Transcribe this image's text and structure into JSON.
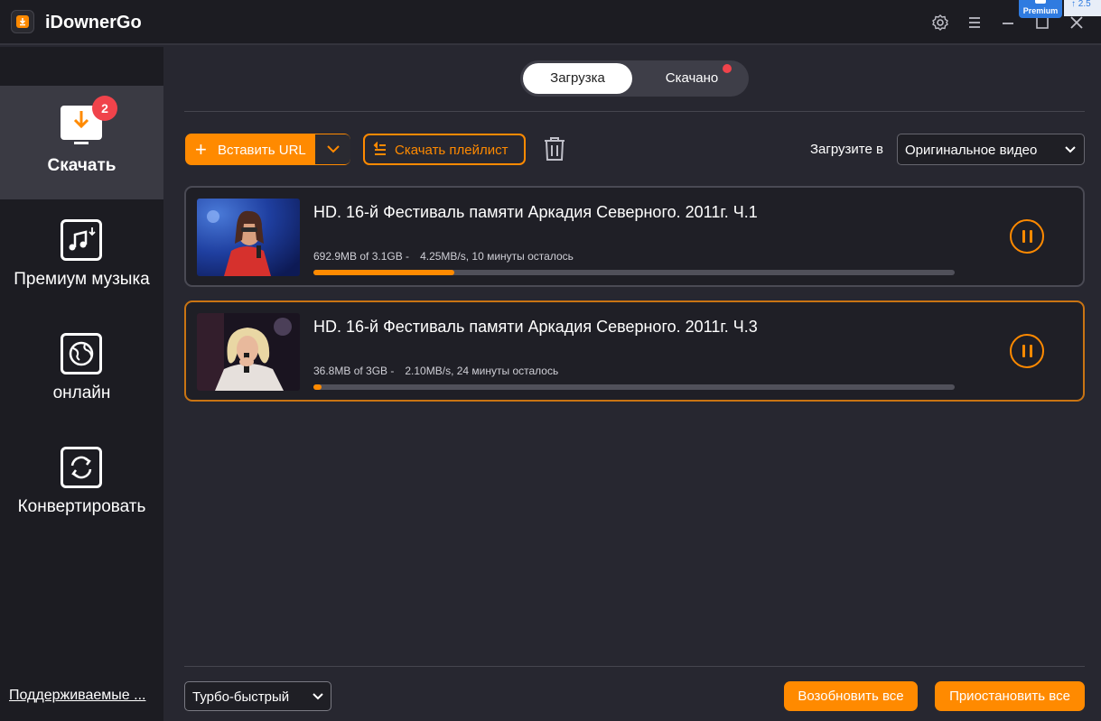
{
  "app": {
    "title": "iDownerGo",
    "premium_label": "Premium",
    "corner_peek_text": "↑ 2.5",
    "icons": [
      "app-logo-icon",
      "settings-icon",
      "menu-icon",
      "minimize-icon",
      "maximize-icon",
      "close-icon"
    ]
  },
  "sidebar": {
    "items": [
      {
        "label": "Скачать",
        "icon": "download-monitor-icon",
        "badge": "2",
        "active": true
      },
      {
        "label": "Премиум музыка",
        "icon": "music-download-icon",
        "active": false
      },
      {
        "label": "онлайн",
        "icon": "globe-icon",
        "active": false
      },
      {
        "label": "Конвертировать",
        "icon": "convert-icon",
        "active": false
      }
    ],
    "supported_link": "Поддерживаемые ..."
  },
  "tabs": {
    "downloading": "Загрузка",
    "downloaded": "Скачано"
  },
  "toolbar": {
    "paste_url": "Вставить URL",
    "download_playlist": "Скачать плейлист",
    "download_to_label": "Загрузите в",
    "quality_value": "Оригинальное видео"
  },
  "downloads": [
    {
      "title": "HD. 16-й Фестиваль памяти Аркадия Северного. 2011г. Ч.1",
      "progress_text": "692.9MB of 3.1GB -",
      "speed_text": "4.25MB/s, 10 минуты осталось",
      "progress": 0.22
    },
    {
      "title": "HD. 16-й Фестиваль памяти Аркадия Северного. 2011г. Ч.3",
      "progress_text": "36.8MB of 3GB -",
      "speed_text": "2.10MB/s, 24 минуты осталось",
      "progress": 0.012
    }
  ],
  "footer": {
    "speed_mode": "Турбо-быстрый",
    "resume_all": "Возобновить все",
    "pause_all": "Приостановить все"
  },
  "colors": {
    "accent": "#ff8a00",
    "badge": "#f0434b",
    "background": "#272730",
    "sidebar": "#1c1c22"
  }
}
